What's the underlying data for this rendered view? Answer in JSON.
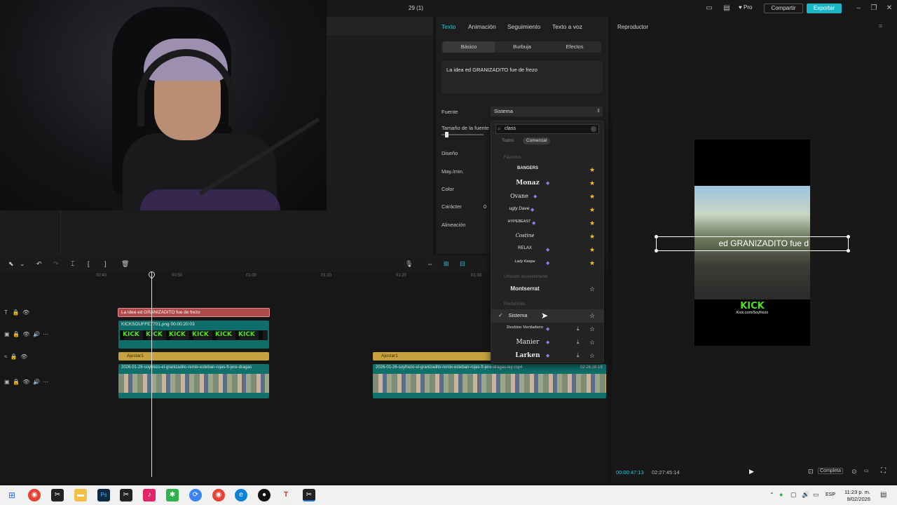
{
  "titlebar": {
    "title": "29 (1)",
    "pro": "Pro",
    "share": "Compartir",
    "export": "Exportar"
  },
  "text_panel": {
    "tabs": [
      "Texto",
      "Animación",
      "Seguimiento",
      "Texto a voz"
    ],
    "subtabs": [
      "Básico",
      "Burbuja",
      "Efectos"
    ],
    "text_value": "La idea ed GRANIZADITO  fue de frezo",
    "labels": {
      "font": "Fuente",
      "font_size": "Tamaño de la fuente",
      "design": "Diseño",
      "case": "May./min.",
      "color": "Color",
      "character": "Carácter",
      "alignment": "Alineación"
    },
    "font_value": "Sistema",
    "character_value": "0"
  },
  "font_dropdown": {
    "search_value": "class",
    "chips": [
      "Todos",
      "Comercial"
    ],
    "sections": {
      "favorites": "Favoritos",
      "recent": "Utilizado recientemente",
      "predefined": "Predefinido"
    },
    "favorites": [
      {
        "name": "BANGERS",
        "pro": false,
        "starred": true
      },
      {
        "name": "Monaz",
        "pro": true,
        "starred": true
      },
      {
        "name": "Ovane",
        "pro": true,
        "starred": true
      },
      {
        "name": "ugly Dave",
        "pro": true,
        "starred": true
      },
      {
        "name": "HYPEBEAST",
        "pro": true,
        "starred": true
      },
      {
        "name": "Costine",
        "pro": false,
        "starred": true
      },
      {
        "name": "RELAX",
        "pro": true,
        "starred": true
      },
      {
        "name": "Lady Keepe",
        "pro": true,
        "starred": true
      }
    ],
    "recent": [
      {
        "name": "Montserrat"
      }
    ],
    "predefined": [
      {
        "name": "Sistema",
        "selected": true
      },
      {
        "name": "Destino Verdadero",
        "pro": true
      },
      {
        "name": "Manier",
        "pro": true
      },
      {
        "name": "Larken",
        "pro": true
      }
    ]
  },
  "player": {
    "title": "Reproductor",
    "overlay_text": "ed GRANIZADITO  fue d",
    "kick_logo": "KICK",
    "kick_url": "Kick.com/Soyfrezo",
    "current_time": "00:00:47:13",
    "total_time": "02:27:45:14",
    "fit": "Completa"
  },
  "timeline": {
    "ruler": [
      "00:40",
      "00:50",
      "01:00",
      "01:10",
      "01:20",
      "01:30"
    ],
    "text_clip": "La idea ed GRANIZADITO  fue de frezo",
    "kick_clip_label": "KICKSOUFFE7701.png  00:00:20:03",
    "kick_word": "KICK",
    "audio_clip_1": "Ajustar1",
    "audio_clip_2": "Ajustar1",
    "video_clip_1": "2026-01-26-soyfrezo-el-granizadito-remix-esteban-rojas-ft-jere-dragas",
    "video_clip_2": "2026-01-26-soyfrezo-el-granizadito-remix-esteban-rojas-ft-jere-dragas-ley-mp4",
    "video_clip_2_duration": "02:26:28:19"
  },
  "taskbar": {
    "language": "ESP",
    "time": "11:23 p. m.",
    "date": "9/02/2026"
  },
  "colors": {
    "accent": "#26c6da",
    "text_clip": "#b0494a",
    "audio": "#c7a23e",
    "video": "#10706b",
    "kick_green": "#52e01e",
    "star": "#f5c518"
  }
}
